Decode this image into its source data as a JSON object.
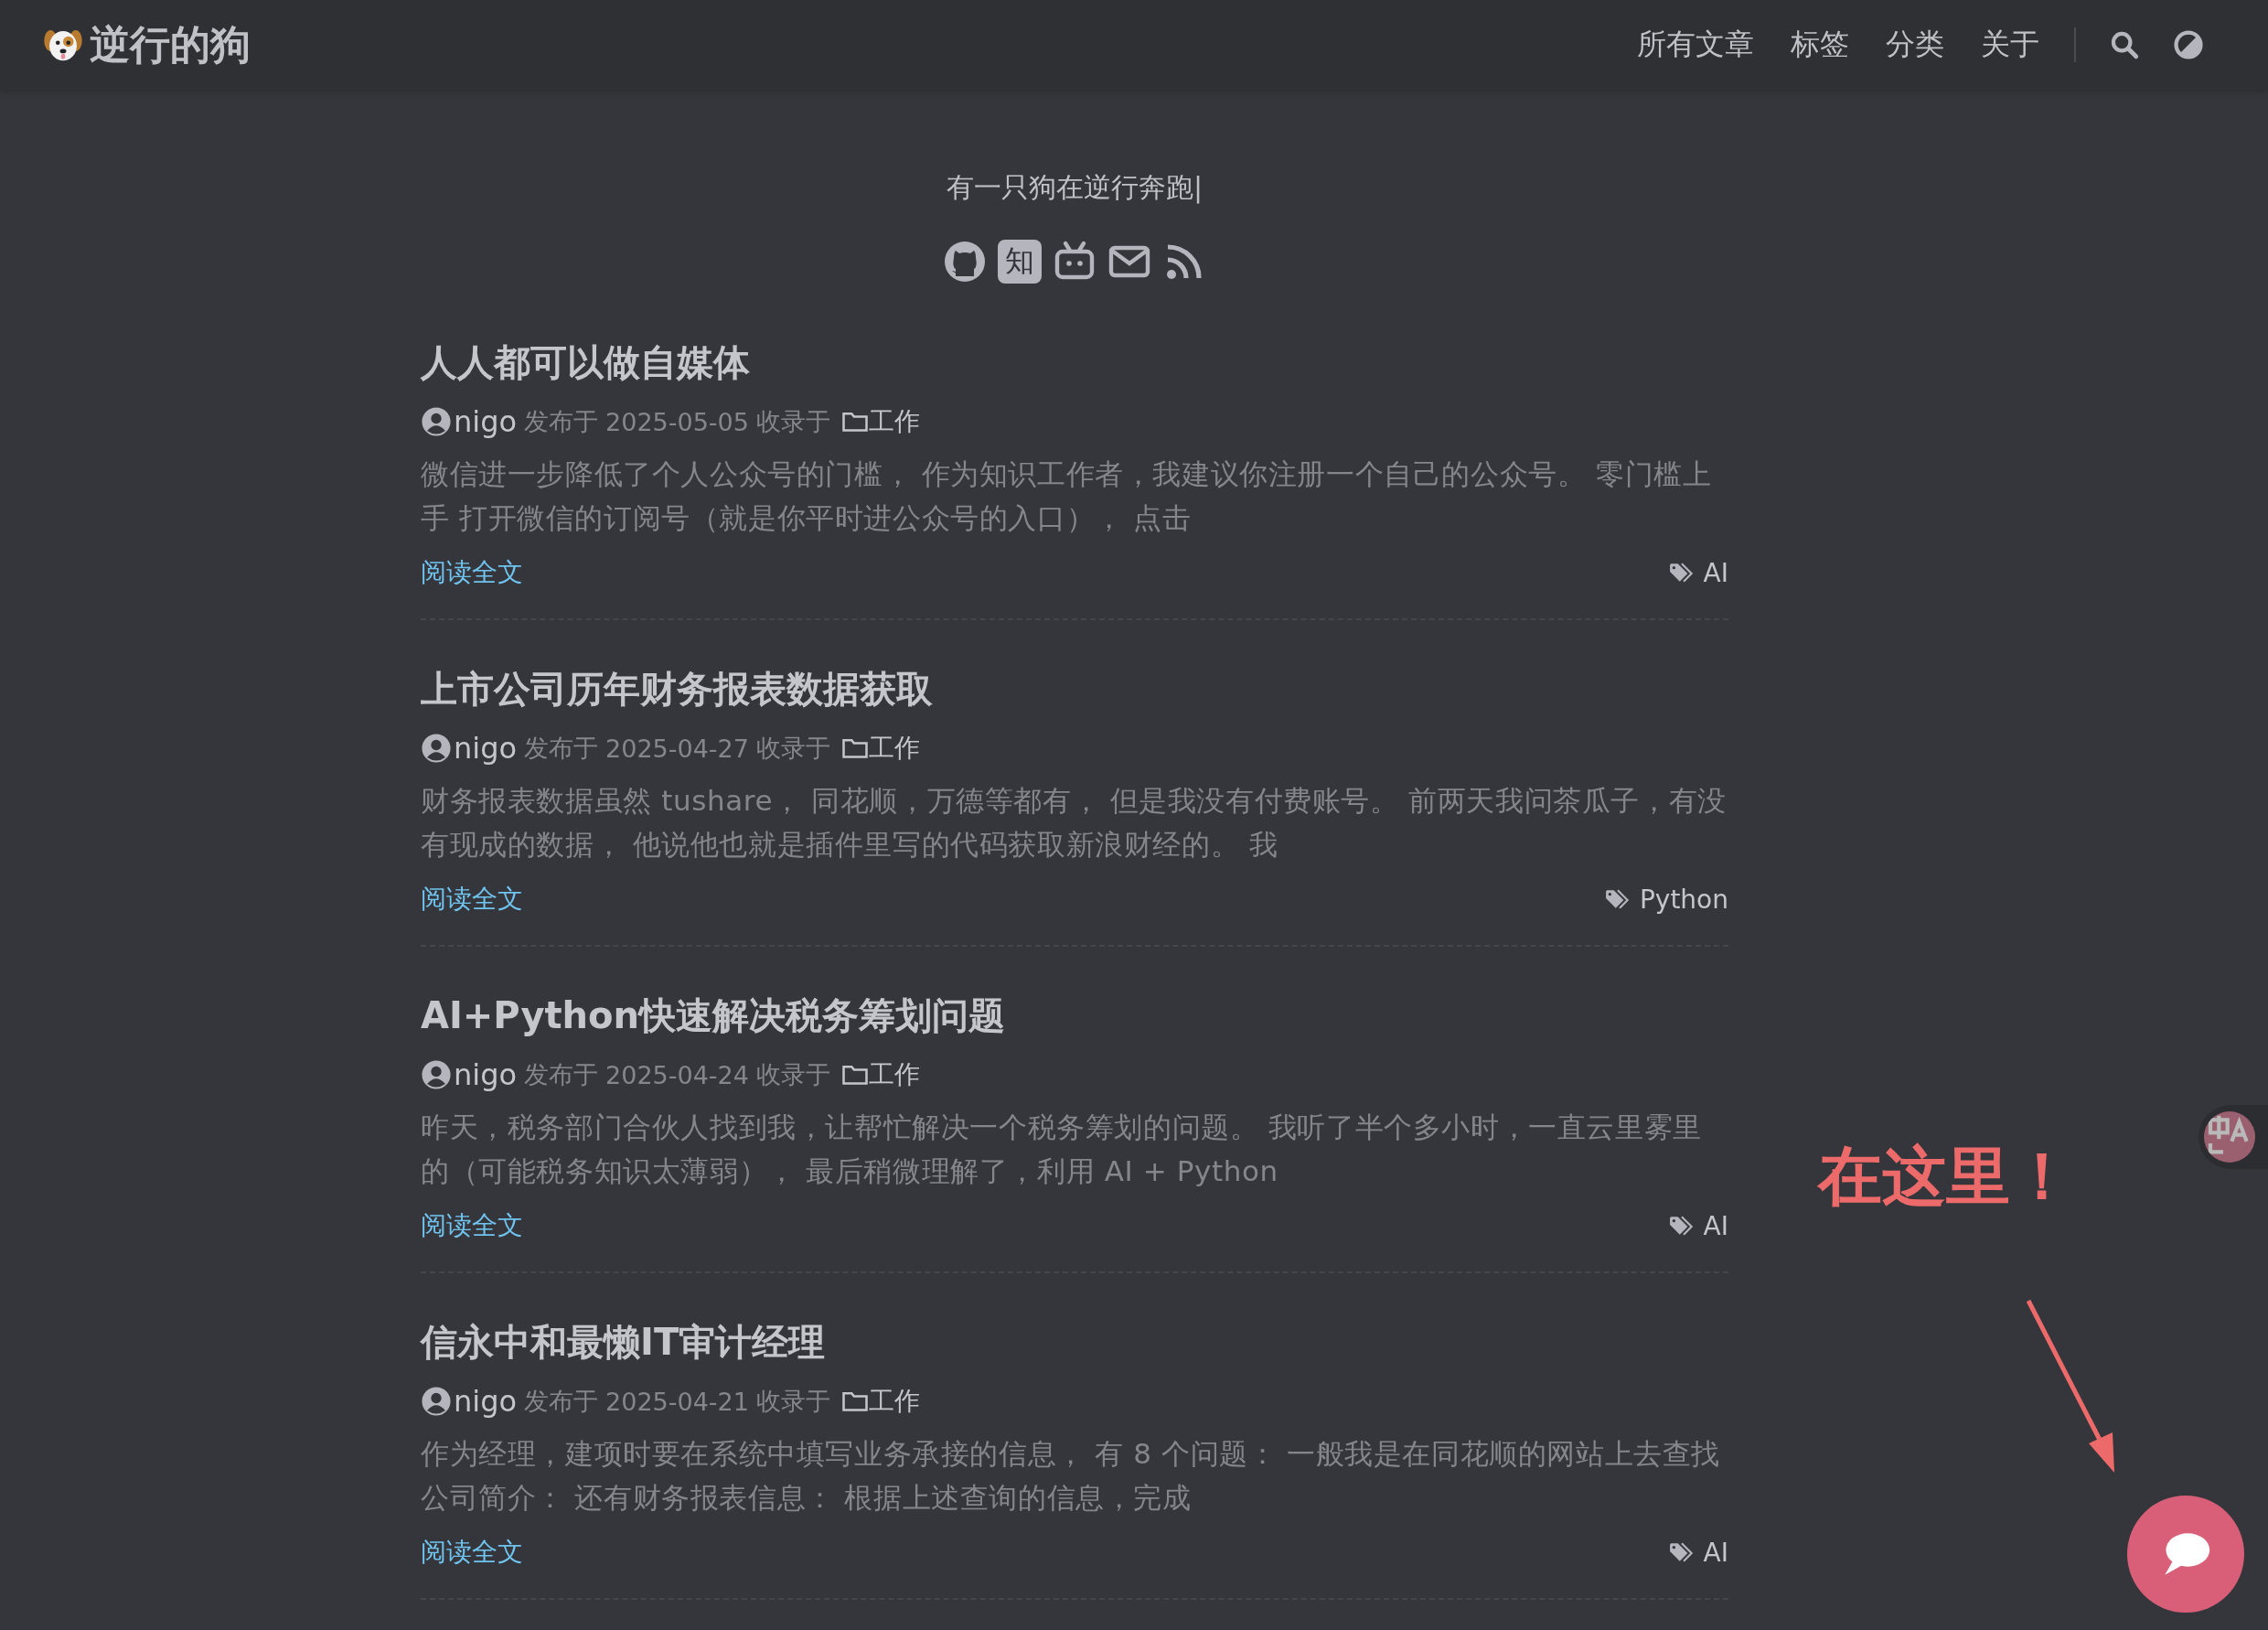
{
  "site": {
    "title": "逆行的狗"
  },
  "nav": {
    "items": [
      {
        "label": "所有文章"
      },
      {
        "label": "标签"
      },
      {
        "label": "分类"
      },
      {
        "label": "关于"
      }
    ]
  },
  "hero": {
    "subtitle": "有一只狗在逆行奔跑|",
    "social": [
      {
        "kind": "github"
      },
      {
        "kind": "zhihu",
        "label": "知"
      },
      {
        "kind": "bilibili"
      },
      {
        "kind": "email"
      },
      {
        "kind": "rss"
      }
    ]
  },
  "posts": [
    {
      "title": "人人都可以做自媒体",
      "author": "nigo",
      "date_label": "发布于",
      "date": "2025-05-05",
      "category_label": "收录于",
      "category": "工作",
      "summary": "微信进一步降低了个人公众号的门槛， 作为知识工作者，我建议你注册一个自己的公众号。 零门槛上手 打开微信的订阅号（就是你平时进公众号的入口）， 点击",
      "read_more": "阅读全文",
      "tag": "AI"
    },
    {
      "title": "上市公司历年财务报表数据获取",
      "author": "nigo",
      "date_label": "发布于",
      "date": "2025-04-27",
      "category_label": "收录于",
      "category": "工作",
      "summary": "财务报表数据虽然 tushare， 同花顺，万德等都有， 但是我没有付费账号。 前两天我问茶瓜子，有没有现成的数据， 他说他也就是插件里写的代码获取新浪财经的。 我",
      "read_more": "阅读全文",
      "tag": "Python"
    },
    {
      "title": "AI+Python快速解决税务筹划问题",
      "author": "nigo",
      "date_label": "发布于",
      "date": "2025-04-24",
      "category_label": "收录于",
      "category": "工作",
      "summary": "昨天，税务部门合伙人找到我，让帮忙解决一个税务筹划的问题。 我听了半个多小时，一直云里雾里的（可能税务知识太薄弱）， 最后稍微理解了，利用 AI + Python",
      "read_more": "阅读全文",
      "tag": "AI"
    },
    {
      "title": "信永中和最懒IT审计经理",
      "author": "nigo",
      "date_label": "发布于",
      "date": "2025-04-21",
      "category_label": "收录于",
      "category": "工作",
      "summary": "作为经理，建项时要在系统中填写业务承接的信息， 有 8 个问题： 一般我是在同花顺的网站上去查找公司简介： 还有财务报表信息： 根据上述查询的信息，完成",
      "read_more": "阅读全文",
      "tag": "AI"
    }
  ],
  "annotation": {
    "text": "在这里！"
  }
}
